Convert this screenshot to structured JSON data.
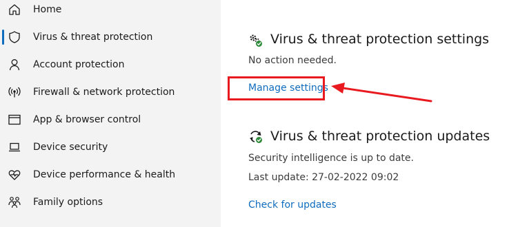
{
  "sidebar": {
    "items": [
      {
        "label": "Home",
        "icon": "home-icon"
      },
      {
        "label": "Virus & threat protection",
        "icon": "shield-icon",
        "active": true
      },
      {
        "label": "Account protection",
        "icon": "person-icon"
      },
      {
        "label": "Firewall & network protection",
        "icon": "wifi-broadcast-icon"
      },
      {
        "label": "App & browser control",
        "icon": "browser-window-icon"
      },
      {
        "label": "Device security",
        "icon": "laptop-icon"
      },
      {
        "label": "Device performance & health",
        "icon": "heart-pulse-icon"
      },
      {
        "label": "Family options",
        "icon": "family-icon"
      }
    ]
  },
  "settings_section": {
    "title": "Virus & threat protection settings",
    "status": "No action needed.",
    "link": "Manage settings",
    "icon": "gears-check-icon"
  },
  "updates_section": {
    "title": "Virus & threat protection updates",
    "status": "Security intelligence is up to date.",
    "last_update": "Last update: 27-02-2022 09:02",
    "link": "Check for updates",
    "icon": "refresh-check-icon"
  },
  "colors": {
    "accent": "#0f6cbd",
    "annotation": "#e8191f",
    "sidebar_bg": "#f3f3f3",
    "status_ok": "#2e8b3a"
  }
}
